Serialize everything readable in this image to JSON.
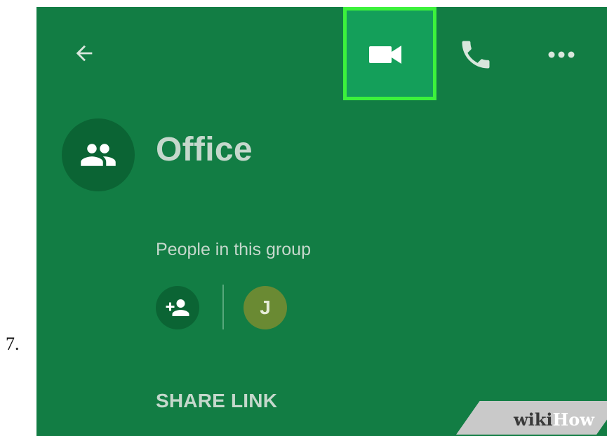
{
  "step": {
    "number": "7."
  },
  "toolbar": {
    "back_icon": "arrow-left-icon",
    "video_icon": "videocam-icon",
    "phone_icon": "phone-icon",
    "more_icon": "more-horizontal-icon"
  },
  "group": {
    "icon": "group-icon",
    "name": "Office"
  },
  "people": {
    "label": "People in this group",
    "add_icon": "add-person-icon",
    "members": [
      {
        "initial": "J",
        "color": "#6a8a33"
      }
    ]
  },
  "actions": {
    "share_link": "SHARE LINK"
  },
  "watermark": {
    "wiki": "wiki",
    "how": "How"
  },
  "colors": {
    "background": "#127d44",
    "highlight_border": "#3cf23c",
    "highlight_fill": "#149f5a",
    "avatar_bg": "#0b6434",
    "text": "#c5d8cc"
  }
}
